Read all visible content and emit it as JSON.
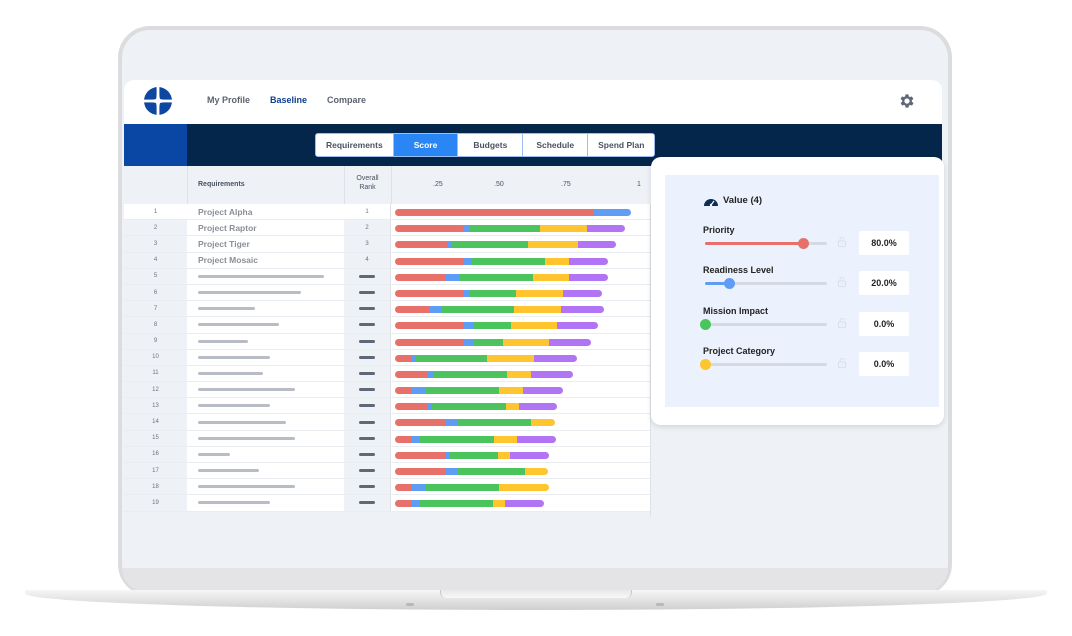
{
  "nav": {
    "items": [
      {
        "label": "My Profile",
        "active": false
      },
      {
        "label": "Baseline",
        "active": true
      },
      {
        "label": "Compare",
        "active": false
      }
    ]
  },
  "tabs": [
    {
      "label": "Requirements",
      "active": false
    },
    {
      "label": "Score",
      "active": true
    },
    {
      "label": "Budgets",
      "active": false
    },
    {
      "label": "Schedule",
      "active": false
    },
    {
      "label": "Spend Plan",
      "active": false
    }
  ],
  "table": {
    "headers": {
      "requirements": "Requirements",
      "rank_line1": "Overall",
      "rank_line2": "Rank"
    },
    "axis_ticks": [
      ".25",
      ".50",
      ".75",
      "1"
    ],
    "colors": {
      "priority": "#e8706a",
      "readiness": "#5f9cf5",
      "mission": "#4cc45e",
      "category": "#fec52f",
      "other": "#b074f5"
    },
    "rows": [
      {
        "num": "1",
        "name": "Project Alpha",
        "rank": "1",
        "highlight": true,
        "segments": [
          0.59,
          0.11,
          0,
          0,
          0
        ]
      },
      {
        "num": "2",
        "name": "Project Raptor",
        "rank": "2",
        "segments": [
          0.2,
          0.02,
          0.21,
          0.14,
          0.11
        ]
      },
      {
        "num": "3",
        "name": "Project Tiger",
        "rank": "3",
        "segments": [
          0.155,
          0.01,
          0.23,
          0.146,
          0.115
        ]
      },
      {
        "num": "4",
        "name": "Project Mosaic",
        "rank": "4",
        "segments": [
          0.2,
          0.025,
          0.22,
          0.07,
          0.115
        ]
      },
      {
        "num": "5",
        "name": "",
        "placeholder": 0.93,
        "rank": "",
        "segments": [
          0.15,
          0.04,
          0.22,
          0.105,
          0.115
        ]
      },
      {
        "num": "6",
        "name": "",
        "placeholder": 0.76,
        "rank": "",
        "segments": [
          0.2,
          0.018,
          0.14,
          0.14,
          0.115
        ]
      },
      {
        "num": "7",
        "name": "",
        "placeholder": 0.42,
        "rank": "",
        "segments": [
          0.1,
          0.038,
          0.215,
          0.14,
          0.125
        ]
      },
      {
        "num": "8",
        "name": "",
        "placeholder": 0.6,
        "rank": "",
        "segments": [
          0.2,
          0.035,
          0.11,
          0.136,
          0.12
        ]
      },
      {
        "num": "9",
        "name": "",
        "placeholder": 0.37,
        "rank": "",
        "segments": [
          0.2,
          0.035,
          0.085,
          0.135,
          0.125
        ]
      },
      {
        "num": "10",
        "name": "",
        "placeholder": 0.53,
        "rank": "",
        "segments": [
          0.05,
          0.01,
          0.213,
          0.14,
          0.125
        ]
      },
      {
        "num": "11",
        "name": "",
        "placeholder": 0.48,
        "rank": "",
        "segments": [
          0.097,
          0.02,
          0.215,
          0.07,
          0.124
        ]
      },
      {
        "num": "12",
        "name": "",
        "placeholder": 0.72,
        "rank": "",
        "segments": [
          0.05,
          0.04,
          0.218,
          0.07,
          0.12
        ]
      },
      {
        "num": "13",
        "name": "",
        "placeholder": 0.53,
        "rank": "",
        "segments": [
          0.097,
          0.01,
          0.222,
          0.037,
          0.115
        ]
      },
      {
        "num": "14",
        "name": "",
        "placeholder": 0.65,
        "rank": "",
        "segments": [
          0.15,
          0.036,
          0.218,
          0.07,
          0
        ]
      },
      {
        "num": "15",
        "name": "",
        "placeholder": 0.72,
        "rank": "",
        "segments": [
          0.05,
          0.02,
          0.222,
          0.07,
          0.115
        ]
      },
      {
        "num": "16",
        "name": "",
        "placeholder": 0.24,
        "rank": "",
        "segments": [
          0.15,
          0.01,
          0.145,
          0.037,
          0.115
        ]
      },
      {
        "num": "17",
        "name": "",
        "placeholder": 0.45,
        "rank": "",
        "segments": [
          0.15,
          0.036,
          0.198,
          0.07,
          0
        ]
      },
      {
        "num": "18",
        "name": "",
        "placeholder": 0.72,
        "rank": "",
        "segments": [
          0.05,
          0.04,
          0.218,
          0.147,
          0
        ]
      },
      {
        "num": "19",
        "name": "",
        "placeholder": 0.53,
        "rank": "",
        "segments": [
          0.05,
          0.02,
          0.22,
          0.037,
          0.115
        ]
      }
    ]
  },
  "panel": {
    "title": "Value (4)",
    "icon": "gauge-icon",
    "sliders": [
      {
        "label": "Priority",
        "value": 0.8,
        "display": "80.0%",
        "color": "#e8706a"
      },
      {
        "label": "Readiness Level",
        "value": 0.2,
        "display": "20.0%",
        "color": "#5f9cf5"
      },
      {
        "label": "Mission Impact",
        "value": 0.0,
        "display": "0.0%",
        "color": "#4cc45e"
      },
      {
        "label": "Project Category",
        "value": 0.0,
        "display": "0.0%",
        "color": "#fec52f"
      }
    ]
  }
}
